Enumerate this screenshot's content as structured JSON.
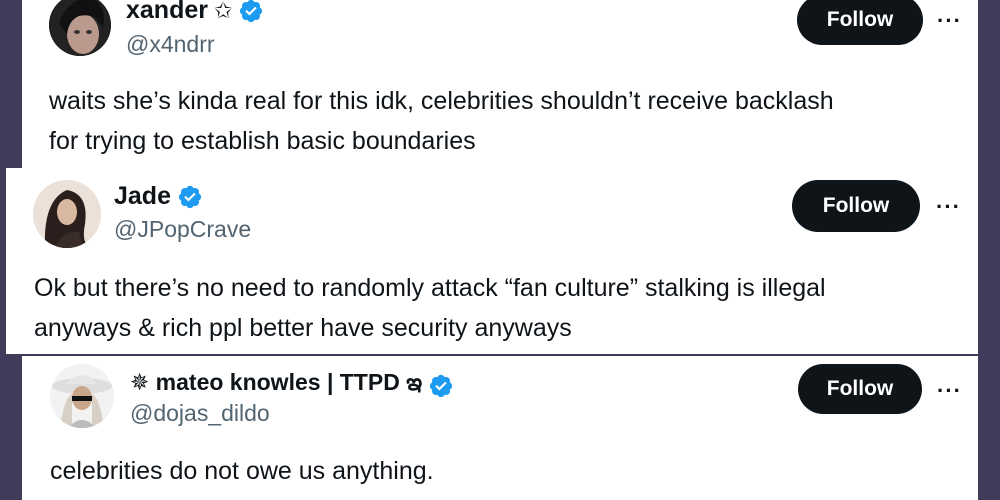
{
  "tweets": [
    {
      "display_name": "xander",
      "name_suffix": "✩",
      "handle": "@x4ndrr",
      "verified": true,
      "follow_label": "Follow",
      "more_label": "···",
      "lines": [
        "waits she’s kinda real for this idk, celebrities shouldn’t receive backlash",
        "for trying to establish basic boundaries"
      ]
    },
    {
      "display_name": "Jade",
      "name_suffix": "",
      "handle": "@JPopCrave",
      "verified": true,
      "follow_label": "Follow",
      "more_label": "···",
      "lines": [
        "Ok but there’s no need to randomly attack “fan culture” stalking is illegal",
        "anyways & rich ppl better have security anyways"
      ]
    },
    {
      "display_name": "✵ mateo knowles | TTPD ఇ",
      "name_suffix": "",
      "handle": "@dojas_dildo",
      "verified": true,
      "follow_label": "Follow",
      "more_label": "···",
      "lines": [
        "celebrities do not owe us anything."
      ]
    }
  ],
  "colors": {
    "background": "#3f3b5a",
    "verified_blue": "#1d9bf0",
    "follow_button": "#0f1419",
    "handle_gray": "#536471"
  }
}
